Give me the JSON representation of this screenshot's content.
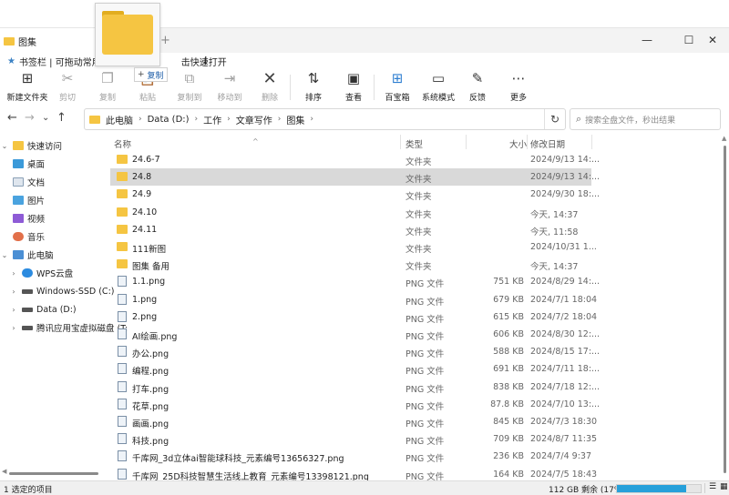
{
  "window": {
    "tab_title": "图集",
    "new_tab": "+",
    "minimize": "—",
    "maximize": "☐",
    "close": "✕"
  },
  "bookmarks": {
    "icon": "star-icon",
    "text_left": "书签栏 | 可拖动常用工",
    "text_right": "击快速打开"
  },
  "drag": {
    "tooltip_plus": "+",
    "tooltip_text": "复制"
  },
  "toolbar": {
    "new_folder": "新建文件夹",
    "cut": "剪切",
    "copy": "复制",
    "paste": "粘贴",
    "copy_to": "复制到",
    "move_to": "移动到",
    "delete": "删除",
    "sort": "排序",
    "view": "查看",
    "treasure": "百宝箱",
    "system_mode": "系统模式",
    "feedback": "反馈",
    "more": "更多"
  },
  "address": {
    "crumbs": [
      "此电脑",
      "Data (D:)",
      "工作",
      "文章写作",
      "图集"
    ],
    "search_placeholder": "搜索全盘文件，秒出结果"
  },
  "sidebar": {
    "quick_access": "快速访问",
    "desktop": "桌面",
    "documents": "文档",
    "pictures": "图片",
    "videos": "视频",
    "music": "音乐",
    "this_pc": "此电脑",
    "wps_cloud": "WPS云盘",
    "windows_ssd": "Windows-SSD (C:)",
    "data_d": "Data (D:)",
    "tencent": "腾讯应用宝虚拟磁盘 (T:"
  },
  "columns": {
    "name": "名称",
    "type": "类型",
    "size": "大小",
    "date": "修改日期"
  },
  "rows": [
    {
      "name": "24.6-7",
      "type": "文件夹",
      "size": "",
      "date": "2024/9/13 14:...",
      "kind": "folder"
    },
    {
      "name": "24.8",
      "type": "文件夹",
      "size": "",
      "date": "2024/9/13 14:...",
      "kind": "folder"
    },
    {
      "name": "24.9",
      "type": "文件夹",
      "size": "",
      "date": "2024/9/30 18:...",
      "kind": "folder"
    },
    {
      "name": "24.10",
      "type": "文件夹",
      "size": "",
      "date": "今天, 14:37",
      "kind": "folder"
    },
    {
      "name": "24.11",
      "type": "文件夹",
      "size": "",
      "date": "今天, 11:58",
      "kind": "folder"
    },
    {
      "name": "111新图",
      "type": "文件夹",
      "size": "",
      "date": "2024/10/31 1...",
      "kind": "folder"
    },
    {
      "name": "图集 备用",
      "type": "文件夹",
      "size": "",
      "date": "今天, 14:37",
      "kind": "folder"
    },
    {
      "name": "1.1.png",
      "type": "PNG 文件",
      "size": "751 KB",
      "date": "2024/8/29 14:...",
      "kind": "png"
    },
    {
      "name": "1.png",
      "type": "PNG 文件",
      "size": "679 KB",
      "date": "2024/7/1 18:04",
      "kind": "png"
    },
    {
      "name": "2.png",
      "type": "PNG 文件",
      "size": "615 KB",
      "date": "2024/7/2 18:04",
      "kind": "png"
    },
    {
      "name": "AI绘画.png",
      "type": "PNG 文件",
      "size": "606 KB",
      "date": "2024/8/30 12:...",
      "kind": "png"
    },
    {
      "name": "办公.png",
      "type": "PNG 文件",
      "size": "588 KB",
      "date": "2024/8/15 17:...",
      "kind": "png"
    },
    {
      "name": "编程.png",
      "type": "PNG 文件",
      "size": "691 KB",
      "date": "2024/7/11 18:...",
      "kind": "png"
    },
    {
      "name": "打车.png",
      "type": "PNG 文件",
      "size": "838 KB",
      "date": "2024/7/18 12:...",
      "kind": "png"
    },
    {
      "name": "花草.png",
      "type": "PNG 文件",
      "size": "87.8 KB",
      "date": "2024/7/10 13:...",
      "kind": "png"
    },
    {
      "name": "画画.png",
      "type": "PNG 文件",
      "size": "845 KB",
      "date": "2024/7/3 18:30",
      "kind": "png"
    },
    {
      "name": "科技.png",
      "type": "PNG 文件",
      "size": "709 KB",
      "date": "2024/8/7 11:35",
      "kind": "png"
    },
    {
      "name": "千库网_3d立体ai智能球科技_元素编号13656327.png",
      "type": "PNG 文件",
      "size": "236 KB",
      "date": "2024/7/4 9:37",
      "kind": "png"
    },
    {
      "name": "千库网_25D科技智慧生活线上教育_元素编号13398121.png",
      "type": "PNG 文件",
      "size": "164 KB",
      "date": "2024/7/5 18:43",
      "kind": "png"
    }
  ],
  "status": {
    "left": "1 选定的项目",
    "right": "112 GB 剩余 (17%)",
    "used_fraction": 0.83
  }
}
